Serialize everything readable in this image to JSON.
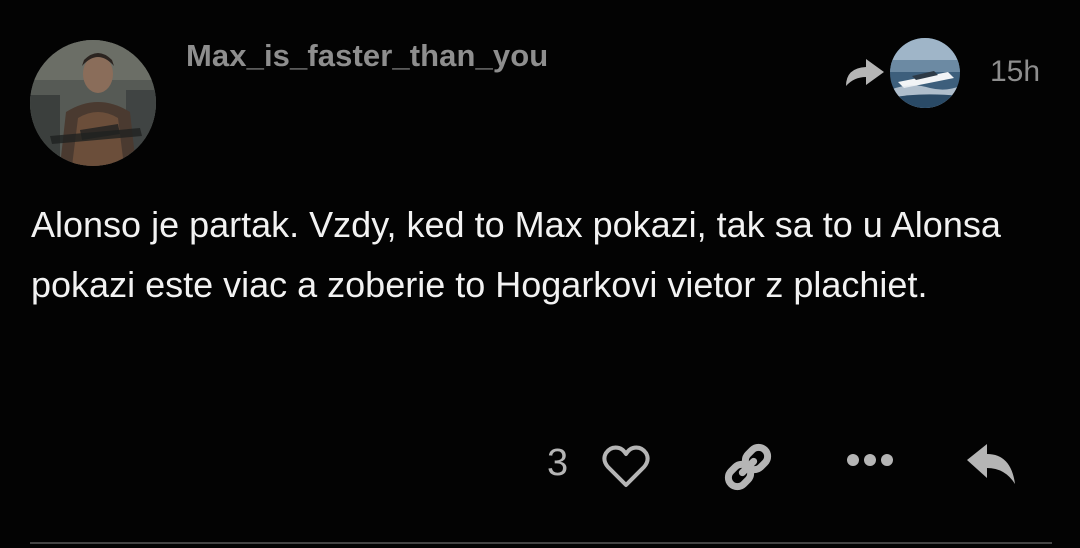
{
  "post": {
    "username": "Max_is_faster_than_you",
    "timestamp": "15h",
    "body": "Alonso je partak. Vzdy, ked to Max pokazi, tak sa to u Alonsa pokazi este viac a zoberie to Hogarkovi vietor z plachiet.",
    "like_count": "3"
  },
  "icons": {
    "reply_to": "reply-arrow-icon",
    "like": "heart-icon",
    "link": "link-icon",
    "more": "ellipsis-icon",
    "reply": "reply-icon"
  },
  "colors": {
    "background": "#030303",
    "text": "#f2f2f2",
    "muted": "#8e8e8e",
    "icon": "#b5b5b5"
  }
}
